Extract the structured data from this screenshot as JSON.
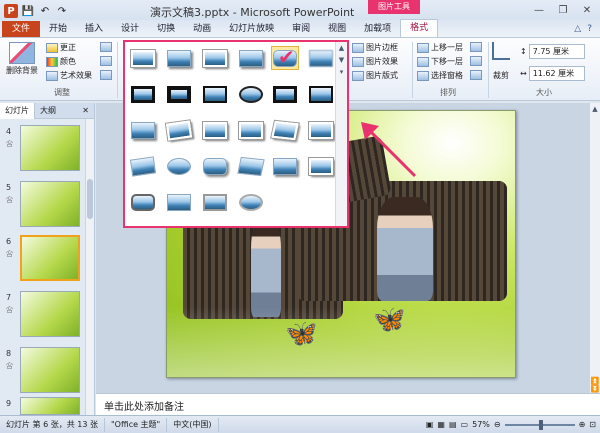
{
  "titlebar": {
    "title": "演示文稿3.pptx - Microsoft PowerPoint",
    "context_group": "图片工具",
    "app_icon": "P",
    "quick_access": [
      "save-icon",
      "undo-icon",
      "redo-icon"
    ]
  },
  "tabs": {
    "file": "文件",
    "items": [
      "开始",
      "插入",
      "设计",
      "切换",
      "动画",
      "幻灯片放映",
      "审阅",
      "视图",
      "加载项"
    ],
    "active": "格式"
  },
  "ribbon": {
    "remove_bg": "删除背景",
    "corrections": "更正",
    "color": "颜色",
    "artistic": "艺术效果",
    "adjust_group": "调整",
    "picture_border": "图片边框",
    "picture_effects": "图片效果",
    "picture_layout": "图片版式",
    "bring_forward": "上移一层",
    "send_backward": "下移一层",
    "selection_pane": "选择窗格",
    "arrange_group": "排列",
    "crop": "裁剪",
    "height": "7.75 厘米",
    "width": "11.62 厘米",
    "size_group": "大小"
  },
  "pane": {
    "tab_slides": "幻灯片",
    "tab_outline": "大纲",
    "close": "✕",
    "slides": [
      {
        "num": "4",
        "star": "吢"
      },
      {
        "num": "5",
        "star": "吢"
      },
      {
        "num": "6",
        "star": "吢"
      },
      {
        "num": "7",
        "star": "吢"
      },
      {
        "num": "8",
        "star": "吢"
      },
      {
        "num": "9",
        "star": "吢"
      }
    ]
  },
  "notes": {
    "placeholder": "单击此处添加备注"
  },
  "status": {
    "slide_info": "幻灯片 第 6 张，共 13 张",
    "theme": "\"Office 主题\"",
    "language": "中文(中国)",
    "zoom": "57%"
  }
}
